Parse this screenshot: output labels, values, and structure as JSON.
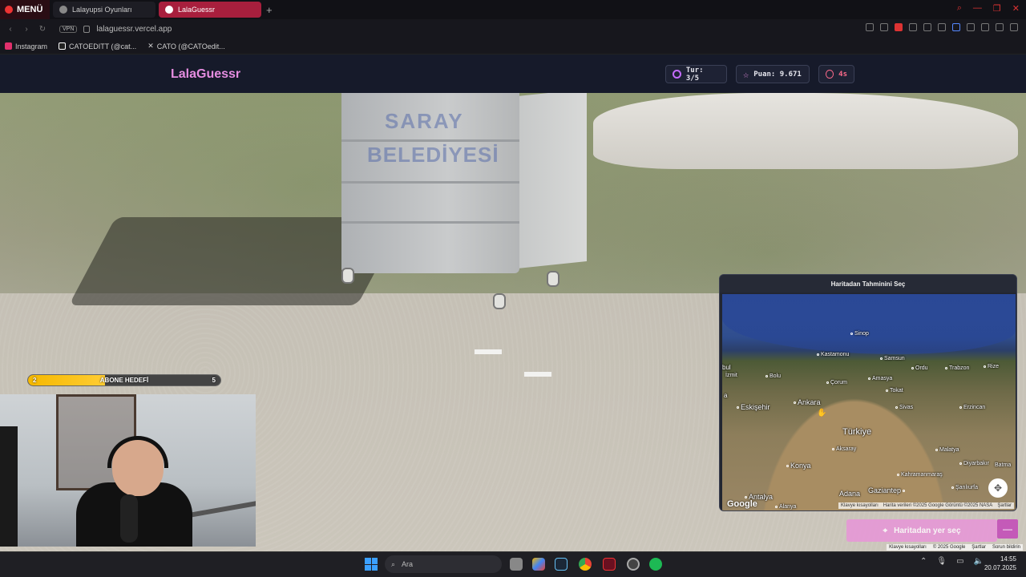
{
  "browser": {
    "menu_label": "MENÜ",
    "tabs": [
      {
        "title": "Lalayupsi Oyunları",
        "active": false
      },
      {
        "title": "LalaGuessr",
        "active": true
      }
    ],
    "new_tab": "+",
    "vpn_label": "VPN",
    "url": "lalaguessr.vercel.app",
    "bookmarks": [
      {
        "label": "Instagram",
        "icon": "instagram-icon",
        "color": "#e1306c"
      },
      {
        "label": "CATOEDITT (@cat...",
        "icon": "tiktok-icon",
        "color": "#ffffff"
      },
      {
        "label": "CATO (@CATOedit...",
        "icon": "x-icon",
        "color": "#ffffff"
      }
    ]
  },
  "game": {
    "brand": "LalaGuessr",
    "round": "Tur: 3/5",
    "score": "Puan: 9.671",
    "timer": "4s",
    "accent": "#e58de0"
  },
  "scene": {
    "container_text_1": "SARAY",
    "container_text_2": "BELEDİYESİ"
  },
  "overlay": {
    "sub_goal": {
      "current": "2",
      "label": "ABONE HEDEFİ",
      "target": "5",
      "progress": 0.4
    }
  },
  "map": {
    "title": "Haritadan Tahminini Seç",
    "cities": [
      {
        "name": "Sinop"
      },
      {
        "name": "Kastamonu"
      },
      {
        "name": "Samsun"
      },
      {
        "name": "Ordu"
      },
      {
        "name": "Trabzon"
      },
      {
        "name": "Rize"
      },
      {
        "name": "bul"
      },
      {
        "name": "Bolu"
      },
      {
        "name": "Çorum"
      },
      {
        "name": "Amasya"
      },
      {
        "name": "İzmit"
      },
      {
        "name": "Tokat"
      },
      {
        "name": "Ankara"
      },
      {
        "name": "Eskişehir"
      },
      {
        "name": "Sivas"
      },
      {
        "name": "Erzincan"
      },
      {
        "name": "Türkiye"
      },
      {
        "name": "Aksaray"
      },
      {
        "name": "Malatya"
      },
      {
        "name": "Konya"
      },
      {
        "name": "Kahramanmaraş"
      },
      {
        "name": "Diyarbakır"
      },
      {
        "name": "Batma"
      },
      {
        "name": "Gaziantep"
      },
      {
        "name": "Adana"
      },
      {
        "name": "Şanlıurfa"
      },
      {
        "name": "Antalya"
      },
      {
        "name": "Alanya"
      },
      {
        "name": "a"
      }
    ],
    "google": "Google",
    "attribution": [
      "Klavye kısayolları",
      "Harita verileri ©2025 Google Görüntü ©2025 NASA",
      "Şartlar"
    ],
    "guess_button": "Haritadan yer seç",
    "collapse": "—"
  },
  "streetview_attribution": [
    "Klavye kısayolları",
    "© 2025 Google",
    "Şartlar",
    "Sorun bildirin"
  ],
  "taskbar": {
    "search_placeholder": "Ara",
    "time": "14:55",
    "date": "20.07.2025"
  }
}
